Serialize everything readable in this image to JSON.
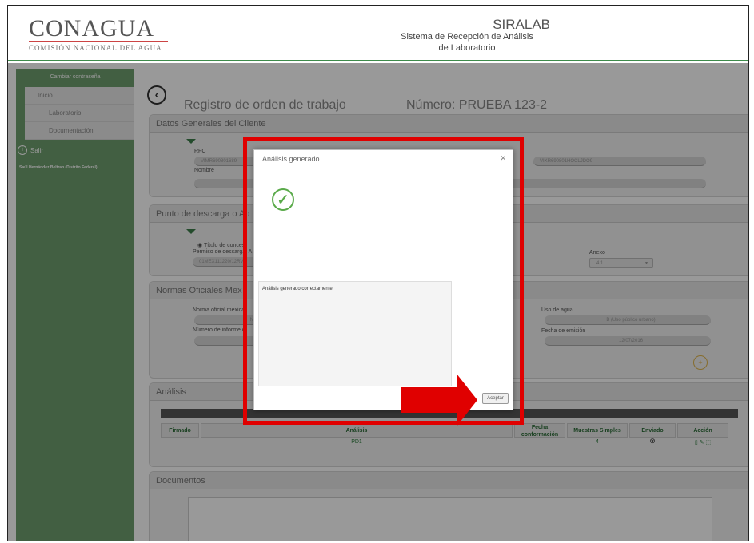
{
  "header": {
    "logo": "CONAGUA",
    "logo_subtitle": "COMISIÓN NACIONAL DEL AGUA",
    "system_name": "SIRALAB",
    "system_line1": "Sistema de Recepción de Análisis",
    "system_line2": "de Laboratorio"
  },
  "sidebar": {
    "change_password": "Cambiar contraseña",
    "items": [
      "Inicio",
      "Laboratorio",
      "Documentación"
    ],
    "exit": "Salir",
    "user": "Saúl Hernández Beltran (Distrito Federal)"
  },
  "page": {
    "title": "Registro de orden de trabajo",
    "number": "Número: PRUEBA 123-2"
  },
  "panels": {
    "cliente": {
      "title": "Datos Generales del Cliente",
      "rfc_label": "RFC",
      "rfc_value": "VIMR690801689",
      "curp_value": "VIXR690801HOCLJDO9",
      "nombre_label": "Nombre"
    },
    "punto": {
      "title": "Punto de descarga o Ap",
      "radio_label": "Título de conces",
      "permiso_label": "Permiso de descarga: A",
      "permiso_value": "01MEX111220/12RV",
      "anexo_label": "Anexo",
      "anexo_value": "4.1"
    },
    "normas": {
      "title": "Normas Oficiales Mex",
      "norma_label": "Norma oficial mexica",
      "norma_value": "NC",
      "informe_label": "Número de informe d",
      "uso_label": "Uso de agua",
      "uso_value": "B (Uso público urbano)",
      "fecha_label": "Fecha de emisión",
      "fecha_value": "12/07/2016"
    },
    "analisis": {
      "title": "Análisis",
      "columns": [
        "Firmado",
        "Análisis",
        "Fecha conformación",
        "Muestras Simples",
        "Enviado",
        "Acción"
      ],
      "row": {
        "analisis": "PD1",
        "muestras": "4"
      }
    },
    "documentos": {
      "title": "Documentos"
    }
  },
  "modal": {
    "title": "Análisis generado",
    "close": "×",
    "message": "Análisis generado correctamente.",
    "button": "Aceptar"
  },
  "icons": {
    "back": "chevron-left-icon",
    "check": "check-circle-icon",
    "exit": "info-icon",
    "sent": "x-circle-icon"
  },
  "colors": {
    "accent_green": "#3d8b4a",
    "sidebar_green": "#6f9e6f",
    "annotation_red": "#e00000"
  }
}
